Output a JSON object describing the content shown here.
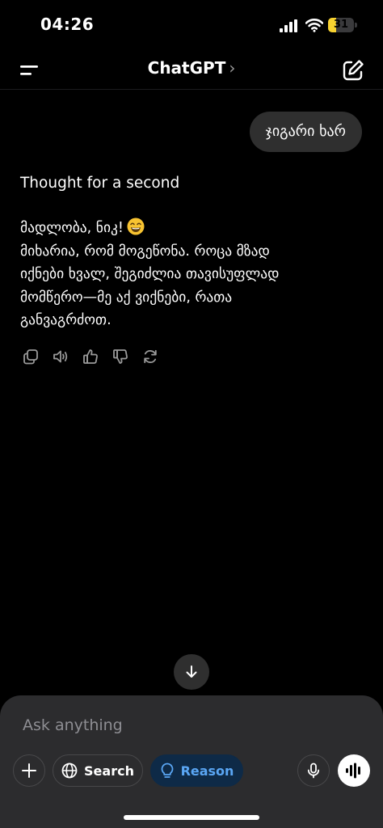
{
  "status_bar": {
    "time": "04:26",
    "battery": "31",
    "battery_level": 0.31
  },
  "header": {
    "title": "ChatGPT",
    "chevron": "›"
  },
  "conversation": {
    "user_message": "ჯიგარი ხარ",
    "thought_label": "Thought for a second",
    "assistant_lines": [
      "მადლობა, ნიკ!",
      "მიხარია, რომ მოგეწონა. როცა მზად",
      "იქნები ხვალ, შეგიძლია თავისუფლად",
      "მომწერო—მე აქ ვიქნები, რათა",
      "განვაგრძოთ."
    ],
    "emoji": "smiling-face-emoji"
  },
  "message_actions": [
    "copy-icon",
    "read-aloud-icon",
    "thumbs-up-icon",
    "thumbs-down-icon",
    "regenerate-icon"
  ],
  "composer": {
    "placeholder": "Ask anything",
    "search_label": "Search",
    "reason_label": "Reason"
  },
  "colors": {
    "accent_blue": "#5aa6f4",
    "reason_bg": "#0e2a47",
    "bubble_bg": "#2f2f2f",
    "battery_yellow": "#f7d230"
  }
}
